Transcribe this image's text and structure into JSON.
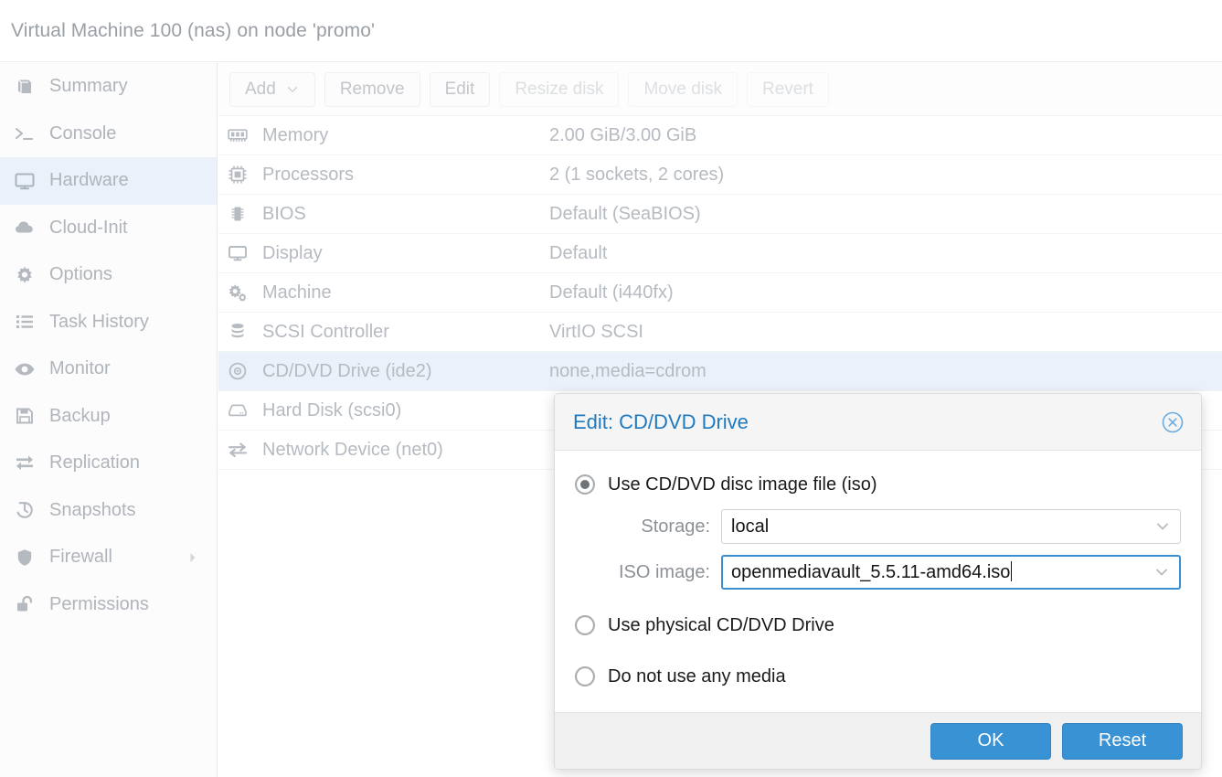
{
  "header": {
    "title": "Virtual Machine 100 (nas) on node 'promo'"
  },
  "sidebar": {
    "items": [
      {
        "label": "Summary",
        "icon": "book-icon",
        "selected": false,
        "submenu": false
      },
      {
        "label": "Console",
        "icon": "terminal-icon",
        "selected": false,
        "submenu": false
      },
      {
        "label": "Hardware",
        "icon": "monitor-icon",
        "selected": true,
        "submenu": false
      },
      {
        "label": "Cloud-Init",
        "icon": "cloud-icon",
        "selected": false,
        "submenu": false
      },
      {
        "label": "Options",
        "icon": "gear-icon",
        "selected": false,
        "submenu": false
      },
      {
        "label": "Task History",
        "icon": "list-icon",
        "selected": false,
        "submenu": false
      },
      {
        "label": "Monitor",
        "icon": "eye-icon",
        "selected": false,
        "submenu": false
      },
      {
        "label": "Backup",
        "icon": "floppy-disk-icon",
        "selected": false,
        "submenu": false
      },
      {
        "label": "Replication",
        "icon": "sync-icon",
        "selected": false,
        "submenu": false
      },
      {
        "label": "Snapshots",
        "icon": "history-icon",
        "selected": false,
        "submenu": false
      },
      {
        "label": "Firewall",
        "icon": "shield-icon",
        "selected": false,
        "submenu": true
      },
      {
        "label": "Permissions",
        "icon": "unlock-icon",
        "selected": false,
        "submenu": false
      }
    ]
  },
  "toolbar": {
    "buttons": [
      {
        "label": "Add",
        "disabled": false,
        "caret": true,
        "name": "add-button"
      },
      {
        "label": "Remove",
        "disabled": false,
        "caret": false,
        "name": "remove-button"
      },
      {
        "label": "Edit",
        "disabled": false,
        "caret": false,
        "name": "edit-button"
      },
      {
        "label": "Resize disk",
        "disabled": true,
        "caret": false,
        "name": "resize-disk-button"
      },
      {
        "label": "Move disk",
        "disabled": true,
        "caret": false,
        "name": "move-disk-button"
      },
      {
        "label": "Revert",
        "disabled": true,
        "caret": false,
        "name": "revert-button"
      }
    ]
  },
  "hardware": {
    "rows": [
      {
        "icon": "memory-icon",
        "name": "Memory",
        "value": "2.00 GiB/3.00 GiB",
        "selected": false
      },
      {
        "icon": "cpu-icon",
        "name": "Processors",
        "value": "2 (1 sockets, 2 cores)",
        "selected": false
      },
      {
        "icon": "bios-chip-icon",
        "name": "BIOS",
        "value": "Default (SeaBIOS)",
        "selected": false
      },
      {
        "icon": "display-icon",
        "name": "Display",
        "value": "Default",
        "selected": false
      },
      {
        "icon": "gears-icon",
        "name": "Machine",
        "value": "Default (i440fx)",
        "selected": false
      },
      {
        "icon": "database-icon",
        "name": "SCSI Controller",
        "value": "VirtIO SCSI",
        "selected": false
      },
      {
        "icon": "cdrom-icon",
        "name": "CD/DVD Drive (ide2)",
        "value": "none,media=cdrom",
        "selected": true
      },
      {
        "icon": "harddisk-icon",
        "name": "Hard Disk (scsi0)",
        "value": "",
        "selected": false
      },
      {
        "icon": "network-icon",
        "name": "Network Device (net0)",
        "value": "",
        "selected": false
      }
    ]
  },
  "dialog": {
    "title": "Edit: CD/DVD Drive",
    "close_icon": "close-circle-icon",
    "options": [
      {
        "label": "Use CD/DVD disc image file (iso)",
        "checked": true
      },
      {
        "label": "Use physical CD/DVD Drive",
        "checked": false
      },
      {
        "label": "Do not use any media",
        "checked": false
      }
    ],
    "fields": [
      {
        "label": "Storage:",
        "value": "local",
        "focused": false,
        "trigger_icon": "chevron-down-icon"
      },
      {
        "label": "ISO image:",
        "value": "openmediavault_5.5.11-amd64.iso",
        "focused": true,
        "trigger_icon": "chevron-down-icon"
      }
    ],
    "buttons": [
      {
        "label": "OK",
        "name": "ok-button"
      },
      {
        "label": "Reset",
        "name": "reset-button"
      }
    ]
  },
  "colors": {
    "accent_blue": "#3892d4",
    "title_blue": "#1f7ac0",
    "selection_blue": "#eaf1fa",
    "muted_text": "#b6bbc1"
  }
}
